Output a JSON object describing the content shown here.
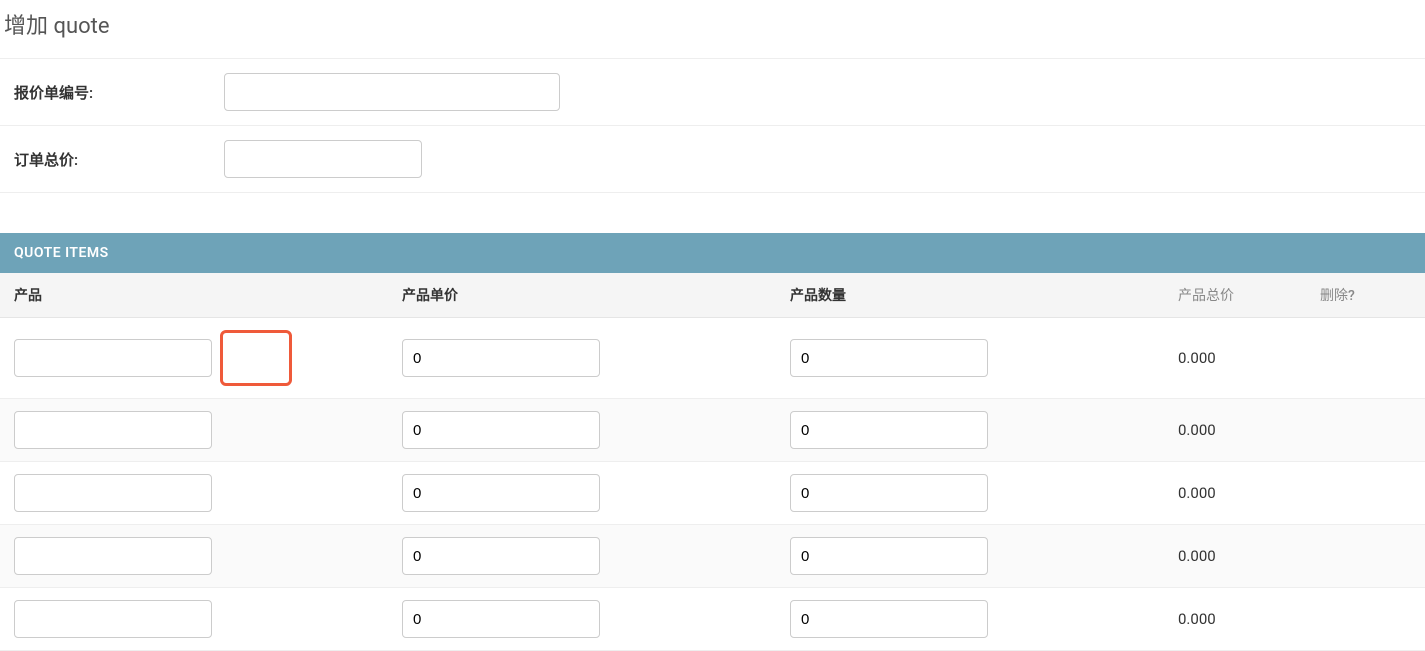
{
  "page": {
    "title": "增加 quote"
  },
  "form": {
    "quote_no_label": "报价单编号:",
    "quote_no_value": "",
    "order_total_label": "订单总价:",
    "order_total_value": ""
  },
  "items_section": {
    "header": "QUOTE ITEMS",
    "columns": {
      "product": "产品",
      "unit_price": "产品单价",
      "quantity": "产品数量",
      "total": "产品总价",
      "delete": "删除?"
    },
    "rows": [
      {
        "product": "",
        "unit_price": "0",
        "quantity": "0",
        "total": "0.000",
        "show_suggest": true
      },
      {
        "product": "",
        "unit_price": "0",
        "quantity": "0",
        "total": "0.000",
        "show_suggest": false
      },
      {
        "product": "",
        "unit_price": "0",
        "quantity": "0",
        "total": "0.000",
        "show_suggest": false
      },
      {
        "product": "",
        "unit_price": "0",
        "quantity": "0",
        "total": "0.000",
        "show_suggest": false
      },
      {
        "product": "",
        "unit_price": "0",
        "quantity": "0",
        "total": "0.000",
        "show_suggest": false
      }
    ]
  }
}
